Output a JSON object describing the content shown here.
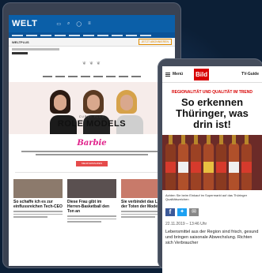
{
  "welt": {
    "logo": "WELT",
    "sub_title": "WELTPLUS",
    "sub_button": "JETZT ABONNIEREN",
    "hero_kicker": "CURVY PLUS",
    "hero_title": "ROLE MODELS",
    "brand": "Barbie",
    "cta": "MEHR ERFAHREN",
    "cards": [
      {
        "headline": "So schaffe ich es zur einflussreichen Tech-CEO",
        "img_color": "#8c7a6c"
      },
      {
        "headline": "Diese Frau gibt im Herren-Basketball den Ton an",
        "img_color": "#5a5050"
      },
      {
        "headline": "Sie verbindet das Leben der Toten der Mode",
        "img_color": "#c87a6a"
      }
    ]
  },
  "bild": {
    "menu_label": "Menü",
    "logo": "Bild",
    "right_label": "TV-Guide",
    "kicker": "REGIONALITÄT UND QUALITÄT IM TREND",
    "headline": "So erkennen Thüringer, was drin ist!",
    "caption": "Achten Sie beim Einkauf im Supermarkt auf das Thüringer Qualitätszeichen",
    "date": "22.11.2019 – 13:46 Uhr",
    "body": "Lebensmittel aus der Region sind frisch, gesund und bringen saisonale Abwechslung. Richten sich Verbraucher"
  },
  "colors": {
    "welt_blue": "#0b5fa8",
    "bild_red": "#d80000",
    "barbie_pink": "#e0218a",
    "background": "#0c1f36"
  }
}
